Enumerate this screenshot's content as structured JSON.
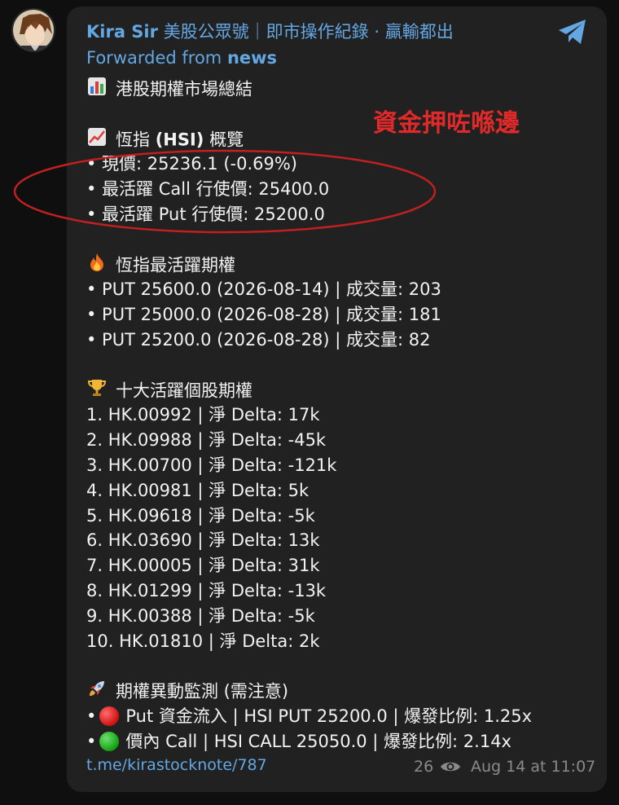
{
  "header": {
    "sender": "Kira Sir",
    "sender_desc": "美股公眾號｜即市操作紀錄 · 贏輸都出",
    "forwarded_prefix": "Forwarded from",
    "forwarded_source": "news"
  },
  "annotation": {
    "text": "資金押咗喺邊",
    "color": "#e02a2a"
  },
  "message": {
    "title": "港股期權市場總結",
    "hsi_header_pre": "恆指",
    "hsi_header_bold": "(HSI)",
    "hsi_header_post": "概覽",
    "hsi_lines": [
      "• 現價: 25236.1 (-0.69%)",
      "• 最活躍 Call 行使價: 25400.0",
      "• 最活躍 Put 行使價: 25200.0"
    ],
    "hot_header": "恆指最活躍期權",
    "hot_lines": [
      "• PUT 25600.0 (2026-08-14) | 成交量: 203",
      "• PUT 25000.0 (2026-08-28) | 成交量: 181",
      "• PUT 25200.0 (2026-08-28) | 成交量: 82"
    ],
    "top10_header": "十大活躍個股期權",
    "top10_lines": [
      "1. HK.00992 | 淨 Delta: 17k",
      "2. HK.09988 | 淨 Delta: -45k",
      "3. HK.00700 | 淨 Delta: -121k",
      "4. HK.00981 | 淨 Delta: 5k",
      "5. HK.09618 | 淨 Delta: -5k",
      "6. HK.03690 | 淨 Delta: 13k",
      "7. HK.00005 | 淨 Delta: 31k",
      "8. HK.01299 | 淨 Delta: -13k",
      "9. HK.00388 | 淨 Delta: -5k",
      "10. HK.01810 | 淨 Delta: 2k"
    ],
    "unusual_header": "期權異動監測 (需注意)",
    "unusual_1": "Put 資金流入 | HSI PUT 25200.0 | 爆發比例: 1.25x",
    "unusual_2": "價內 Call | HSI CALL 25050.0 | 爆發比例: 2.14x"
  },
  "footer": {
    "link": "t.me/kirastocknote/787",
    "views": "26",
    "time": "Aug 14 at 11:07"
  },
  "icons": {
    "title": "bar-chart-icon",
    "hsi": "chart-increasing-icon",
    "hot": "fire-icon",
    "top10": "trophy-icon",
    "unusual": "rocket-icon"
  },
  "colors": {
    "link": "#63a7e3",
    "bubble": "#212121",
    "background": "#0f0f0f"
  }
}
